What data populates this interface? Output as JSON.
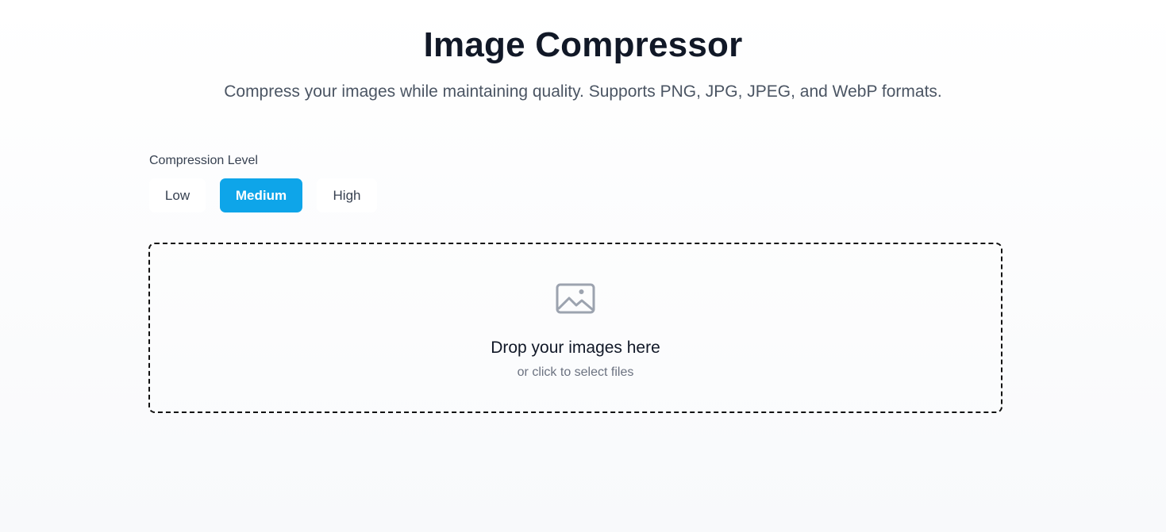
{
  "header": {
    "title": "Image Compressor",
    "subtitle": "Compress your images while maintaining quality. Supports PNG, JPG, JPEG, and WebP formats."
  },
  "compression": {
    "label": "Compression Level",
    "options": [
      "Low",
      "Medium",
      "High"
    ],
    "selected": "Medium"
  },
  "dropzone": {
    "icon": "image-icon",
    "title": "Drop your images here",
    "subtitle": "or click to select files"
  },
  "colors": {
    "accent": "#0ea5e9",
    "title_text": "#111827",
    "muted_text": "#6b7280",
    "icon": "#9ca3af"
  }
}
